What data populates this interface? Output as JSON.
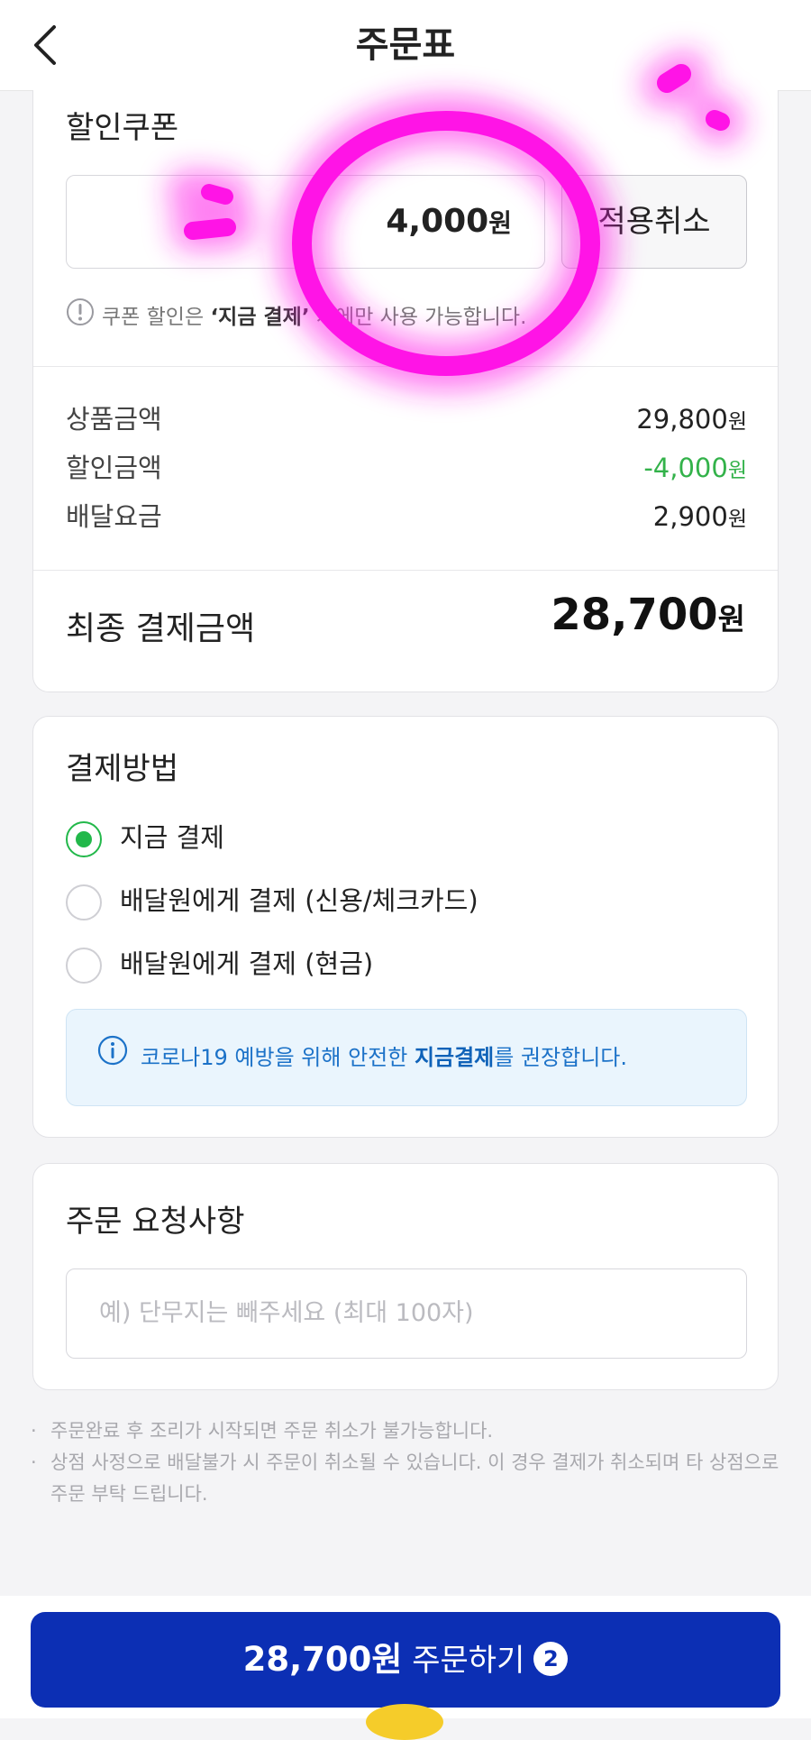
{
  "header": {
    "title": "주문표",
    "back_icon": "chevron-left-icon"
  },
  "coupon": {
    "section_title": "할인쿠폰",
    "amount": "4,000",
    "currency": "원",
    "cancel_label": "적용취소",
    "notice_prefix": "쿠폰 할인은 ",
    "notice_bold": "‘지금 결제’",
    "notice_suffix": " 시에만 사용 가능합니다.",
    "notice_icon": "exclamation-circle-icon"
  },
  "summary": {
    "items": [
      {
        "label": "상품금액",
        "value": "29,800",
        "unit": "원"
      },
      {
        "label": "할인금액",
        "value": "-4,000",
        "unit": "원"
      },
      {
        "label": "배달요금",
        "value": "2,900",
        "unit": "원"
      }
    ],
    "final_label": "최종 결제금액",
    "final_value": "28,700",
    "final_unit": "원"
  },
  "payment": {
    "section_title": "결제방법",
    "options": [
      {
        "label": "지금 결제",
        "selected": true
      },
      {
        "label": "배달원에게 결제 (신용/체크카드)",
        "selected": false
      },
      {
        "label": "배달원에게 결제 (현금)",
        "selected": false
      }
    ],
    "info_prefix": "코로나19 예방을 위해 안전한 ",
    "info_bold": "지금결제",
    "info_suffix": "를 권장합니다.",
    "info_icon": "info-circle-icon"
  },
  "request": {
    "section_title": "주문 요청사항",
    "placeholder": "예) 단무지는 빼주세요 (최대 100자)"
  },
  "footnotes": [
    "주문완료 후 조리가 시작되면 주문 취소가 불가능합니다.",
    "상점 사정으로 배달불가 시 주문이 취소될 수 있습니다. 이 경우 결제가 취소되며 타 상점으로 주문 부탁 드립니다."
  ],
  "order_button": {
    "amount": "28,700원",
    "label": "주문하기",
    "badge": "2"
  },
  "colors": {
    "primary_blue": "#0c2fb4",
    "discount_green": "#33b24a",
    "radio_green": "#22b84a",
    "info_blue": "#1c72c8",
    "annotation_magenta": "#ff1ee8"
  }
}
